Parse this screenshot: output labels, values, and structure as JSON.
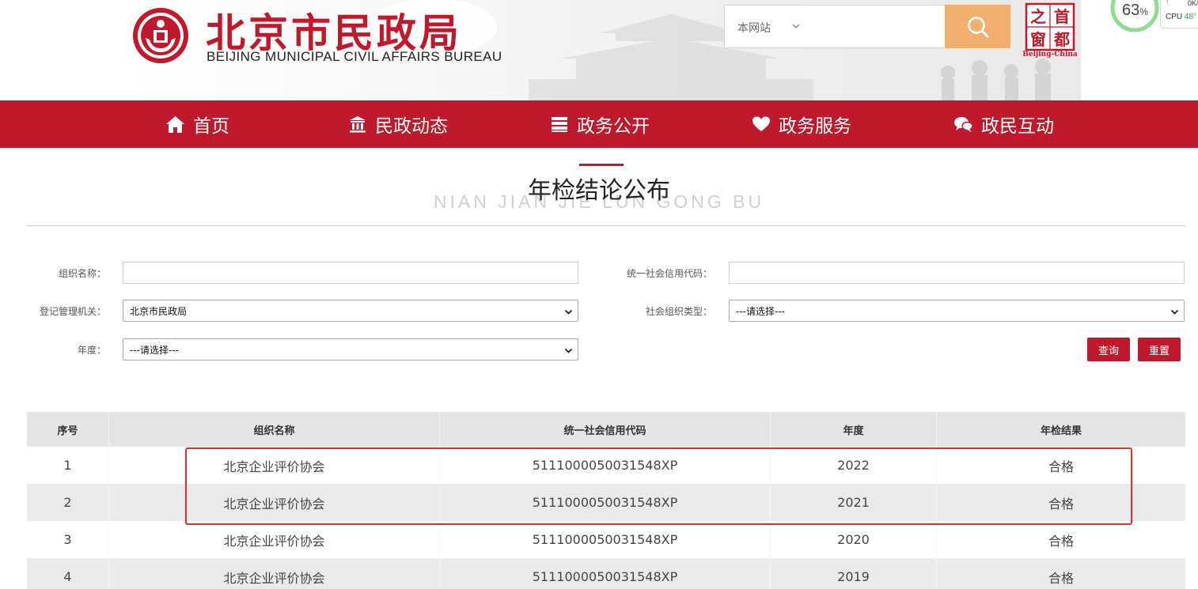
{
  "header": {
    "logo_cn": "北京市民政局",
    "logo_en": "BEIJING MUNICIPAL CIVIL AFFAIRS BUREAU",
    "search_scope": "本网站",
    "search_placeholder": "",
    "capital_badge_chars": [
      "首",
      "都",
      "之",
      "窗"
    ],
    "capital_badge_en": "Beijing-China"
  },
  "system_widget": {
    "cpu_percent": "63",
    "percent_sign": "%",
    "net_speed": "0K/",
    "cpu_label": "CPU",
    "cpu_value": "48°"
  },
  "nav": {
    "items": [
      {
        "label": "首页",
        "icon": "home-icon"
      },
      {
        "label": "民政动态",
        "icon": "building-icon"
      },
      {
        "label": "政务公开",
        "icon": "list-icon"
      },
      {
        "label": "政务服务",
        "icon": "heart-icon"
      },
      {
        "label": "政民互动",
        "icon": "chat-icon"
      }
    ]
  },
  "page": {
    "title": "年检结论公布",
    "subtitle": "NIAN JIAN JIE LUN GONG BU"
  },
  "form": {
    "org_name_label": "组织名称：",
    "org_name_value": "",
    "credit_code_label": "统一社会信用代码：",
    "credit_code_value": "",
    "authority_label": "登记管理机关：",
    "authority_value": "北京市民政局",
    "org_type_label": "社会组织类型：",
    "org_type_value": "---请选择---",
    "year_label": "年度：",
    "year_value": "---请选择---",
    "query_button": "查询",
    "reset_button": "重置"
  },
  "table": {
    "columns": [
      "序号",
      "组织名称",
      "统一社会信用代码",
      "年度",
      "年检结果"
    ],
    "rows": [
      [
        "1",
        "北京企业评价协会",
        "5111000050031548XP",
        "2022",
        "合格"
      ],
      [
        "2",
        "北京企业评价协会",
        "5111000050031548XP",
        "2021",
        "合格"
      ],
      [
        "3",
        "北京企业评价协会",
        "5111000050031548XP",
        "2020",
        "合格"
      ],
      [
        "4",
        "北京企业评价协会",
        "5111000050031548XP",
        "2019",
        "合格"
      ]
    ]
  },
  "colors": {
    "brand_red": "#bf1a2c",
    "search_button": "#f2ae6f",
    "highlight_border": "#e02f2f"
  }
}
